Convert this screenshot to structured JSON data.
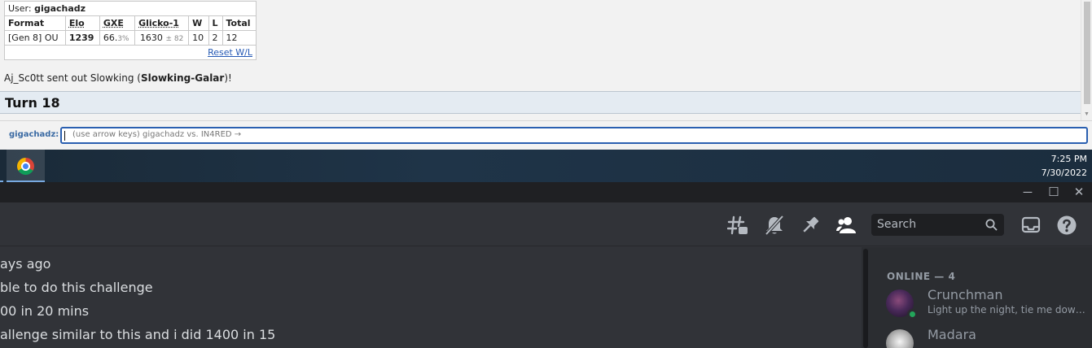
{
  "showdown": {
    "rating_table": {
      "user_label": "User: ",
      "username": "gigachadz",
      "headers": [
        "Format",
        "Elo",
        "GXE",
        "Glicko-1",
        "W",
        "L",
        "Total"
      ],
      "row": {
        "format": "[Gen 8] OU",
        "elo": "1239",
        "gxe_main": "66.",
        "gxe_sub": "3%",
        "glicko_main": "1630",
        "glicko_sub": "± 82",
        "w": "10",
        "l": "2",
        "total": "12"
      },
      "reset_label": "Reset W/L"
    },
    "log": {
      "prefix": "Aj_Sc0tt sent out Slowking (",
      "bold": "Slowking-Galar",
      "suffix": ")!"
    },
    "turn_label": "Turn 18",
    "chat": {
      "user_label": "gigachadz:",
      "placeholder": "(use arrow keys) gigachadz vs. IN4RED →"
    }
  },
  "taskbar": {
    "apps": [
      {
        "icon": "chrome-icon",
        "name": "Google Chrome"
      }
    ],
    "time": "7:25 PM",
    "date": "7/30/2022"
  },
  "discord": {
    "window_controls": [
      "minimize-icon",
      "maximize-icon",
      "close-icon"
    ],
    "header_icons": [
      "threads-icon",
      "mute-bell-icon",
      "pin-icon",
      "member-list-icon"
    ],
    "search_label": "Search",
    "chat_lines": [
      "ays ago",
      "ble to do this challenge",
      "00 in 20 mins",
      "allenge similar to this and i did 1400 in 15"
    ],
    "members": {
      "section_label": "ONLINE — 4",
      "list": [
        {
          "name": "Crunchman",
          "status": "Light up the night, tie me down...",
          "presence": "online"
        },
        {
          "name": "Madara",
          "status": "",
          "presence": "online"
        }
      ]
    },
    "colors": {
      "background": "#313338",
      "sidebar": "#2b2d31",
      "online": "#23a55a"
    }
  }
}
